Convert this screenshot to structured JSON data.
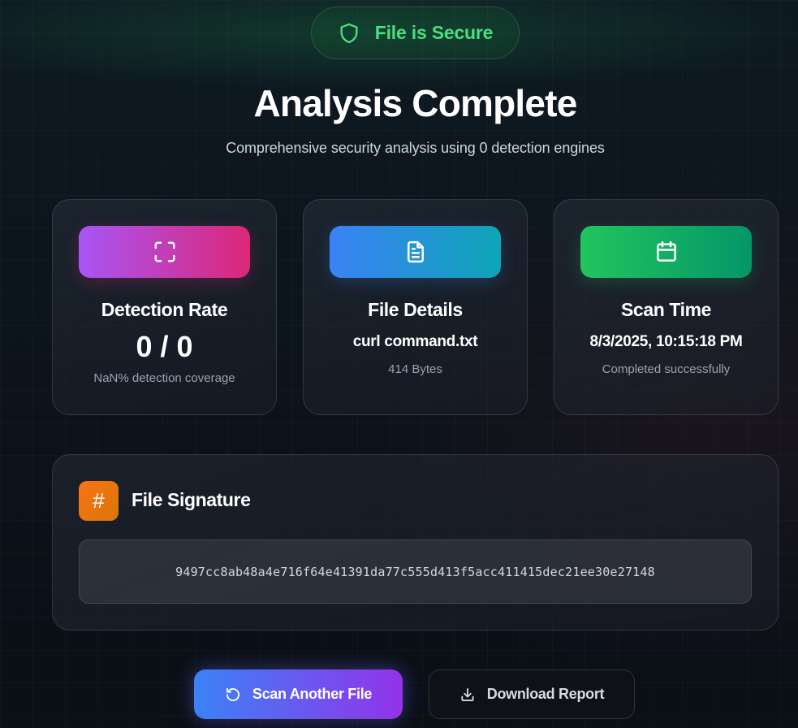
{
  "status_badge": {
    "label": "File is Secure",
    "icon": "shield-icon",
    "color": "#4ade80"
  },
  "header": {
    "title": "Analysis Complete",
    "subtitle": "Comprehensive security analysis using 0 detection engines"
  },
  "cards": {
    "detection": {
      "icon": "scan-frame-icon",
      "title": "Detection Rate",
      "value": "0 / 0",
      "note": "NaN% detection coverage"
    },
    "file": {
      "icon": "document-icon",
      "title": "File Details",
      "value": "curl command.txt",
      "note": "414 Bytes"
    },
    "scan_time": {
      "icon": "calendar-icon",
      "title": "Scan Time",
      "value": "8/3/2025, 10:15:18 PM",
      "note": "Completed successfully"
    }
  },
  "signature": {
    "icon": "hash-icon",
    "icon_glyph": "#",
    "title": "File Signature",
    "hash": "9497cc8ab48a4e716f64e41391da77c555d413f5acc411415dec21ee30e27148"
  },
  "actions": {
    "scan_another": {
      "label": "Scan Another File",
      "icon": "refresh-icon"
    },
    "download_report": {
      "label": "Download Report",
      "icon": "download-icon"
    }
  },
  "colors": {
    "accent_green": "#22c55e",
    "accent_purple": "#a855f7",
    "accent_pink": "#db2777",
    "accent_blue": "#3b82f6",
    "accent_orange": "#f97316"
  }
}
